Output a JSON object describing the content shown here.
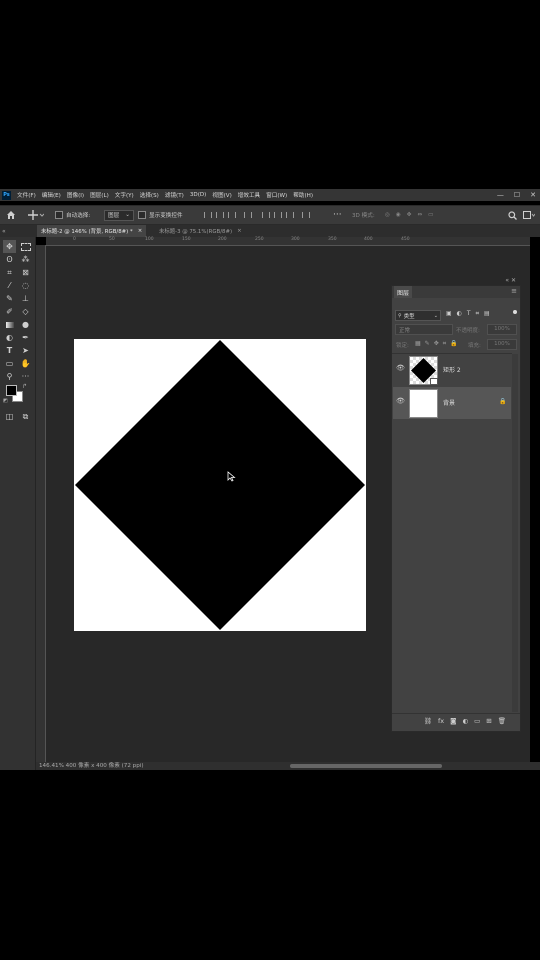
{
  "menubar": {
    "app_icon": "Ps",
    "items": [
      "文件(F)",
      "编辑(E)",
      "图像(I)",
      "图层(L)",
      "文字(Y)",
      "选择(S)",
      "滤镜(T)",
      "3D(D)",
      "视图(V)",
      "增效工具",
      "窗口(W)",
      "帮助(H)"
    ],
    "window_controls": [
      "—",
      "☐",
      "✕"
    ]
  },
  "options": {
    "auto_select_label": "自动选择:",
    "auto_select_value": "图层",
    "show_transform_label": "显示变换控件",
    "mode_3d_label": "3D 模式:"
  },
  "tabs": [
    {
      "label": "未标题-2 @ 146% (背景, RGB/8#) *",
      "close": "×"
    },
    {
      "label": "未标题-3 @ 75.1%(RGB/8#)",
      "close": "×"
    }
  ],
  "ruler": {
    "h_ticks": [
      "0",
      "50",
      "100",
      "150",
      "200",
      "250",
      "300",
      "350",
      "400",
      "450"
    ]
  },
  "layers_panel": {
    "title": "图层",
    "filter_kind": "类型",
    "blend_mode": "正常",
    "opacity_label": "不透明度:",
    "opacity_value": "100%",
    "lock_label": "锁定:",
    "fill_label": "填充:",
    "fill_value": "100%",
    "layers": [
      {
        "name": "矩形 2",
        "visible": true,
        "locked": false
      },
      {
        "name": "背景",
        "visible": true,
        "locked": true
      }
    ]
  },
  "status": {
    "text": "146.41%   400 像素 x 400 像素 (72 ppi)"
  },
  "colors": {
    "foreground": "#000000",
    "background": "#ffffff",
    "accent": "#31a8ff"
  }
}
